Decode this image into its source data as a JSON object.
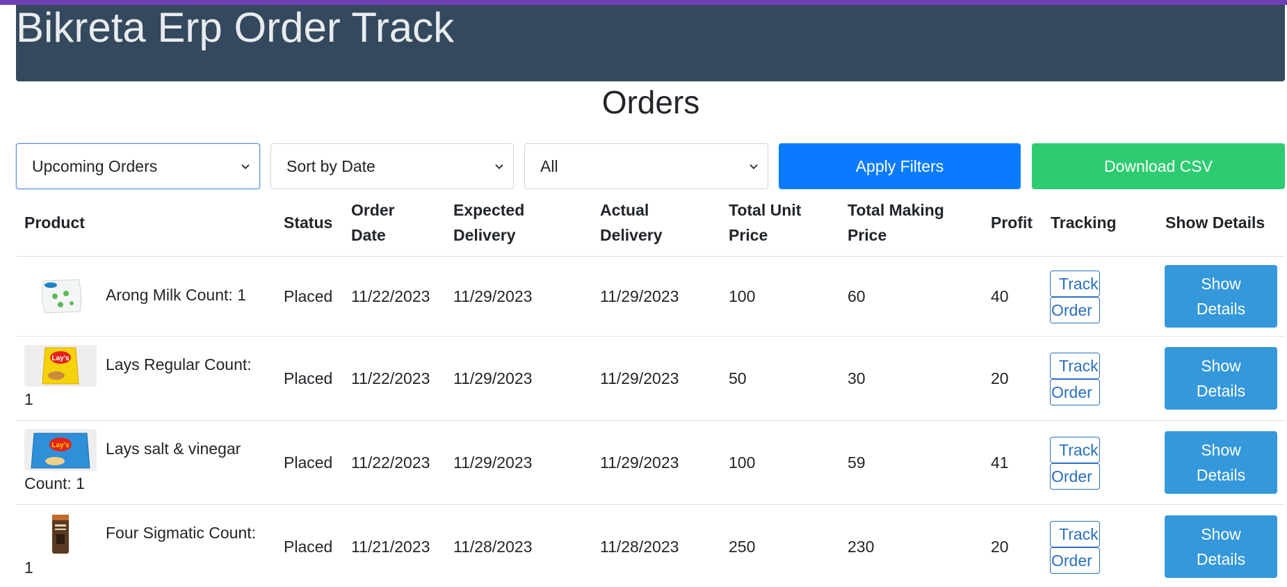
{
  "app": {
    "title": "Bikreta Erp Order Track"
  },
  "page": {
    "title": "Orders"
  },
  "filters": {
    "order_type": "Upcoming Orders",
    "sort": "Sort by Date",
    "category": "All",
    "apply_label": "Apply Filters",
    "csv_label": "Download CSV"
  },
  "table": {
    "headers": {
      "product": "Product",
      "status": "Status",
      "order_date_1": "Order",
      "order_date_2": "Date",
      "expected_1": "Expected",
      "expected_2": "Delivery",
      "actual_1": "Actual",
      "actual_2": "Delivery",
      "unit_1": "Total Unit",
      "unit_2": "Price",
      "making_1": "Total Making",
      "making_2": "Price",
      "profit": "Profit",
      "tracking": "Tracking",
      "details": "Show Details"
    },
    "rows": [
      {
        "product_line1": "Arong Milk Count: 1",
        "product_line2": "",
        "status": "Placed",
        "order_date": "11/22/2023",
        "expected": "11/29/2023",
        "actual": "11/29/2023",
        "unit_price": "100",
        "making_price": "60",
        "profit": "40",
        "track_1": "Track",
        "track_2": "Order",
        "details_1": "Show",
        "details_2": "Details"
      },
      {
        "product_line1": "Lays Regular Count:",
        "product_line2": "1",
        "status": "Placed",
        "order_date": "11/22/2023",
        "expected": "11/29/2023",
        "actual": "11/29/2023",
        "unit_price": "50",
        "making_price": "30",
        "profit": "20",
        "track_1": "Track",
        "track_2": "Order",
        "details_1": "Show",
        "details_2": "Details"
      },
      {
        "product_line1": "Lays salt & vinegar",
        "product_line2": "Count: 1",
        "status": "Placed",
        "order_date": "11/22/2023",
        "expected": "11/29/2023",
        "actual": "11/29/2023",
        "unit_price": "100",
        "making_price": "59",
        "profit": "41",
        "track_1": "Track",
        "track_2": "Order",
        "details_1": "Show",
        "details_2": "Details"
      },
      {
        "product_line1": "Four Sigmatic Count:",
        "product_line2": "1",
        "status": "Placed",
        "order_date": "11/21/2023",
        "expected": "11/28/2023",
        "actual": "11/28/2023",
        "unit_price": "250",
        "making_price": "230",
        "profit": "20",
        "track_1": "Track",
        "track_2": "Order",
        "details_1": "Show",
        "details_2": "Details"
      }
    ]
  },
  "colors": {
    "header_bg": "#34495e",
    "top_accent": "#6f3fb5",
    "apply_btn": "#0a7bff",
    "csv_btn": "#2ecc71",
    "details_btn": "#3498db",
    "link": "#2a6fbd"
  },
  "icons": {
    "select_arrow": "chevron-down-icon"
  }
}
